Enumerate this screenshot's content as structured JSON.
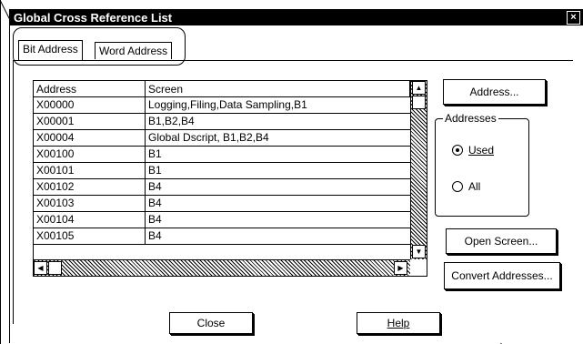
{
  "window": {
    "title": "Global Cross Reference List",
    "close_glyph": "×"
  },
  "tabs": [
    {
      "label": "Bit Address",
      "selected": true
    },
    {
      "label": "Word Address",
      "selected": false
    }
  ],
  "table": {
    "columns": [
      "Address",
      "Screen"
    ],
    "rows": [
      [
        "X00000",
        "Logging,Filing,Data Sampling,B1"
      ],
      [
        "X00001",
        "B1,B2,B4"
      ],
      [
        "X00004",
        "Global Dscript, B1,B2,B4"
      ],
      [
        "X00100",
        "B1"
      ],
      [
        "X00101",
        "B1"
      ],
      [
        "X00102",
        "B4"
      ],
      [
        "X00103",
        "B4"
      ],
      [
        "X00104",
        "B4"
      ],
      [
        "X00105",
        "B4"
      ]
    ]
  },
  "buttons": {
    "address": "Address...",
    "open_screen": "Open Screen...",
    "convert_addresses": "Convert Addresses...",
    "close": "Close",
    "help": "Help"
  },
  "addresses_group": {
    "label": "Addresses",
    "options": [
      {
        "label": "Used",
        "selected": true
      },
      {
        "label": "All",
        "selected": false
      }
    ]
  }
}
